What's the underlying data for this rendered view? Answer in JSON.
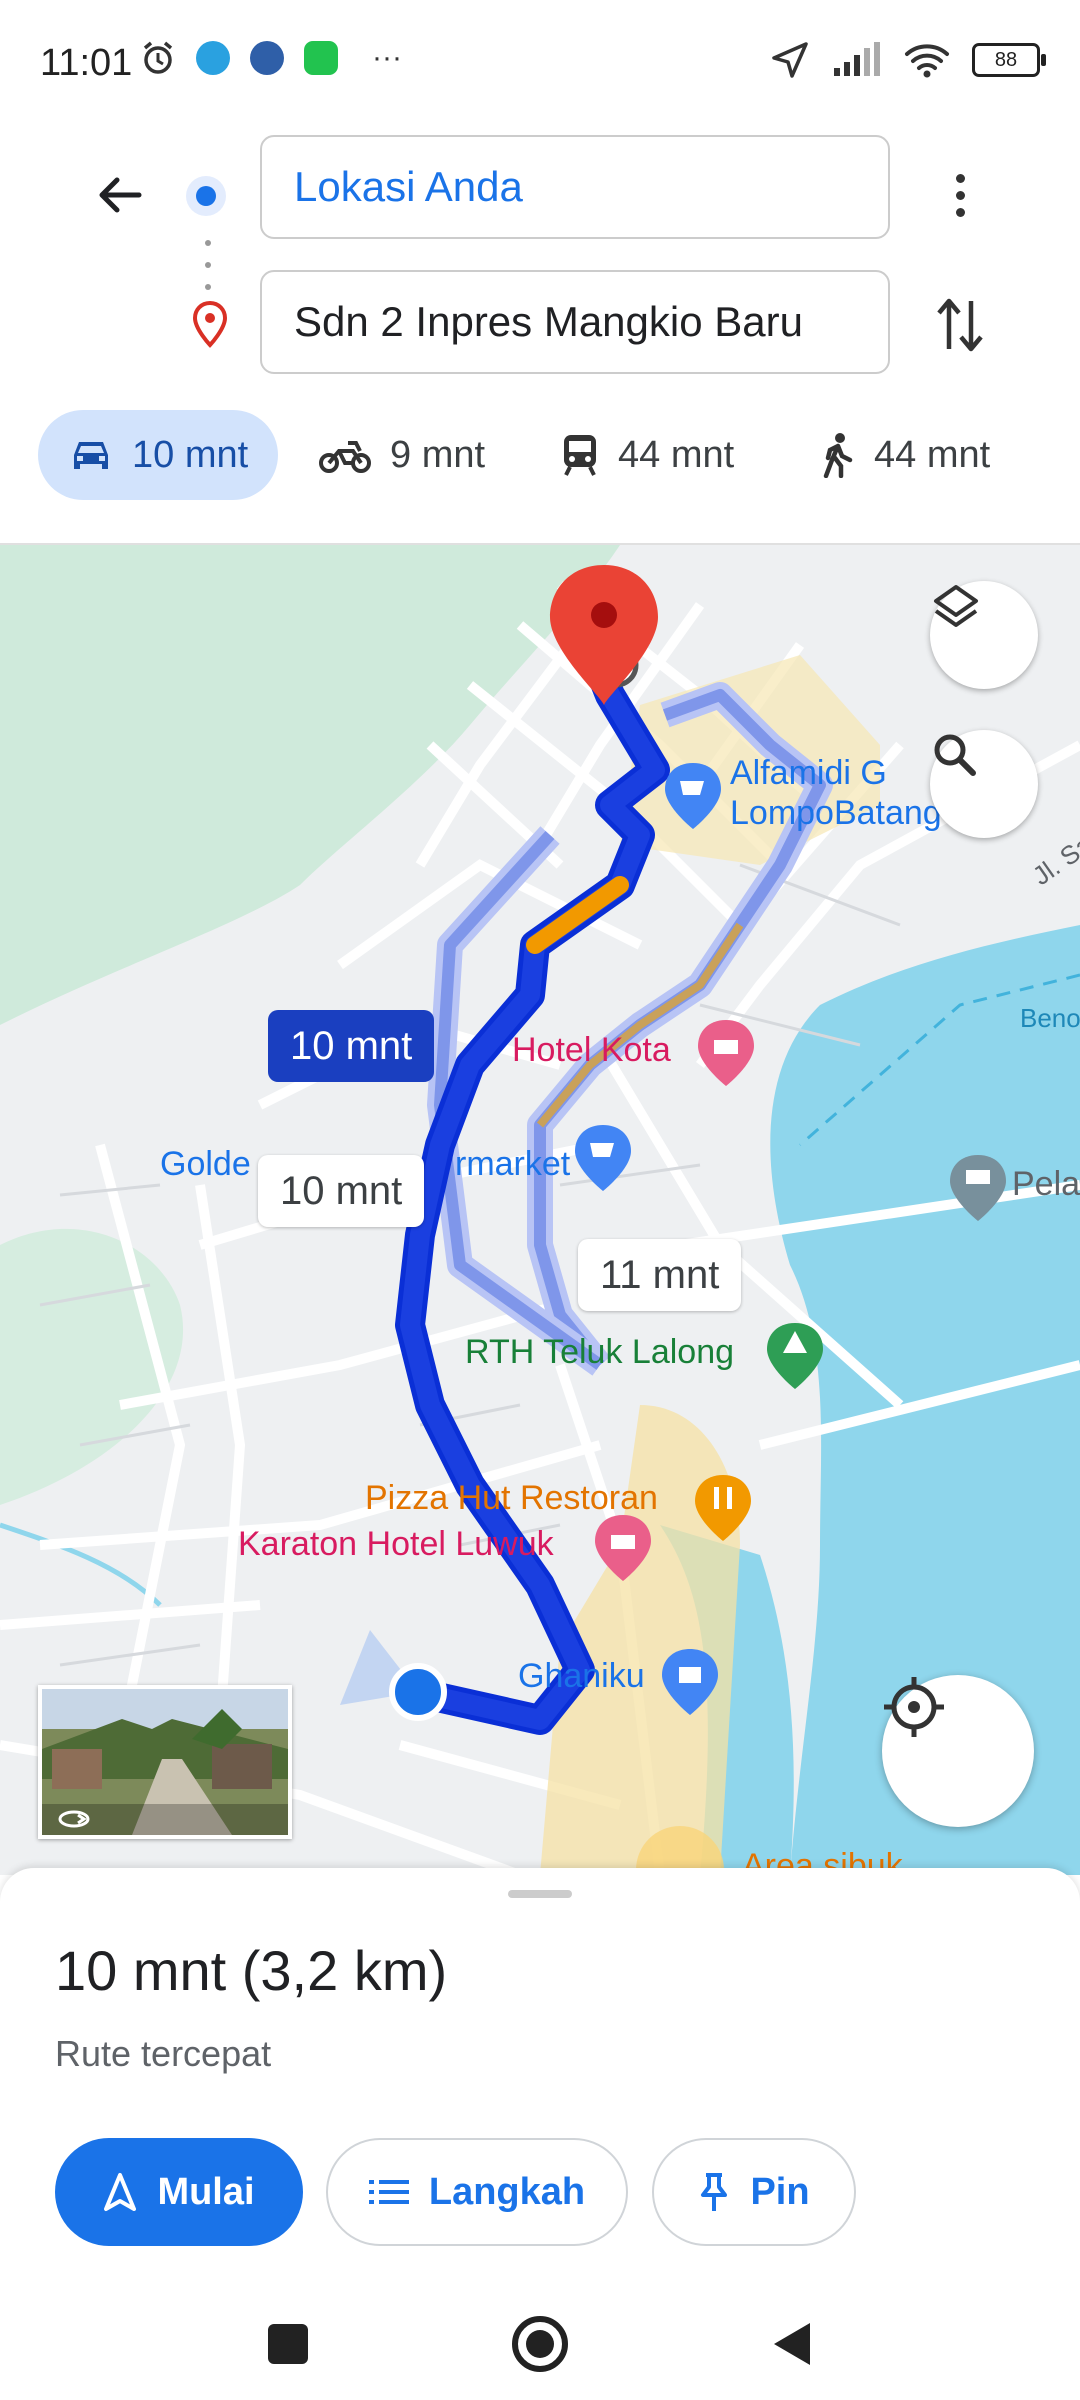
{
  "status_bar": {
    "time": "11:01",
    "battery": "88",
    "left_icons": [
      "alarm-icon",
      "telegram-icon",
      "messaging-icon",
      "line-icon"
    ],
    "overflow": "···"
  },
  "directions": {
    "origin": "Lokasi Anda",
    "destination": "Sdn 2 Inpres Mangkio Baru",
    "modes": [
      {
        "name": "car",
        "time": "10 mnt",
        "active": true
      },
      {
        "name": "motorcycle",
        "time": "9 mnt"
      },
      {
        "name": "transit",
        "time": "44 mnt"
      },
      {
        "name": "walk",
        "time": "44 mnt"
      }
    ]
  },
  "map": {
    "route_chips": {
      "primary": "10 mnt",
      "alt1": "10 mnt",
      "alt2": "11 mnt"
    },
    "places": [
      {
        "id": "alfamidi",
        "line1": "Alfamidi G",
        "line2": "LompoBatang",
        "color": "#1a73e8"
      },
      {
        "id": "hotel-kota",
        "text": "Hotel Kota",
        "color": "#d81b60"
      },
      {
        "id": "golden-hill",
        "text": "Golde",
        "text2": "rmarket",
        "color": "#1a73e8"
      },
      {
        "id": "pela",
        "text": "Pela",
        "color": "#5f6368"
      },
      {
        "id": "rth",
        "text": "RTH Teluk Lalong",
        "color": "#188038"
      },
      {
        "id": "pizza",
        "text": "Pizza Hut Restoran",
        "color": "#e37400"
      },
      {
        "id": "karaton",
        "text": "Karaton Hotel Luwuk",
        "color": "#d81b60"
      },
      {
        "id": "ghaniku",
        "text": "Ghaniku",
        "color": "#1a73e8"
      },
      {
        "id": "area",
        "text": "Area sibuk",
        "color": "#e37400"
      },
      {
        "id": "road-label",
        "text": "Jl. Sa"
      },
      {
        "id": "beno",
        "text": "Beno"
      }
    ]
  },
  "sheet": {
    "summary": "10 mnt (3,2 km)",
    "subtitle": "Rute tercepat",
    "buttons": {
      "start": "Mulai",
      "steps": "Langkah",
      "pin": "Pin"
    }
  },
  "colors": {
    "accent": "#1a73e8",
    "route": "#1a3fe0",
    "water": "#8fd6ec",
    "park": "#cde9da",
    "traffic_slow": "#f29900"
  }
}
